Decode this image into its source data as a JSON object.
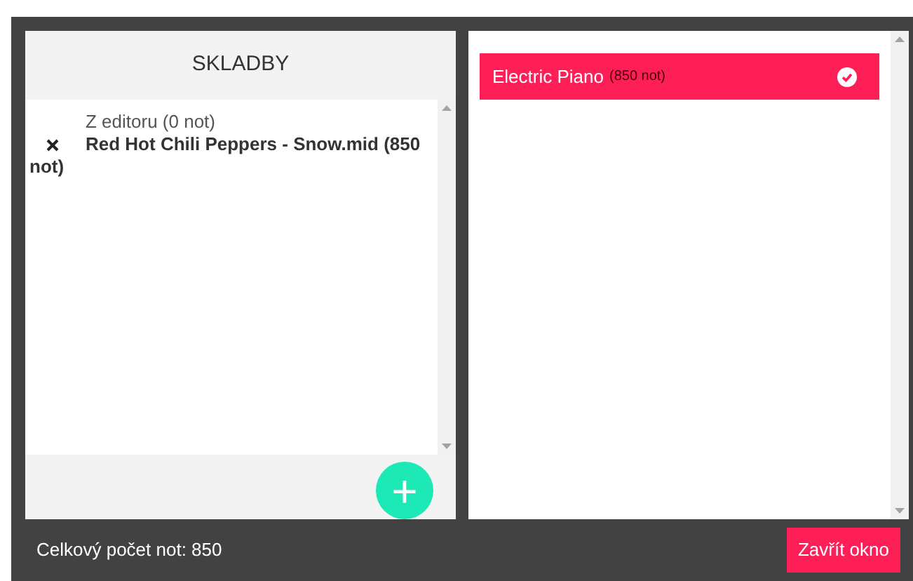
{
  "songs_panel": {
    "title": "SKLADBY",
    "items": [
      {
        "label": "Z editoru (0 not)",
        "removable": false
      },
      {
        "label": "Red Hot Chili Peppers - Snow.mid (850 not)",
        "removable": true
      }
    ],
    "add_button": "+"
  },
  "tracks_panel": {
    "items": [
      {
        "name": "Electric Piano",
        "count": "(850 not)",
        "selected": true
      }
    ]
  },
  "footer": {
    "total": "Celkový počet not: 850",
    "close_button": "Zavřít okno"
  }
}
